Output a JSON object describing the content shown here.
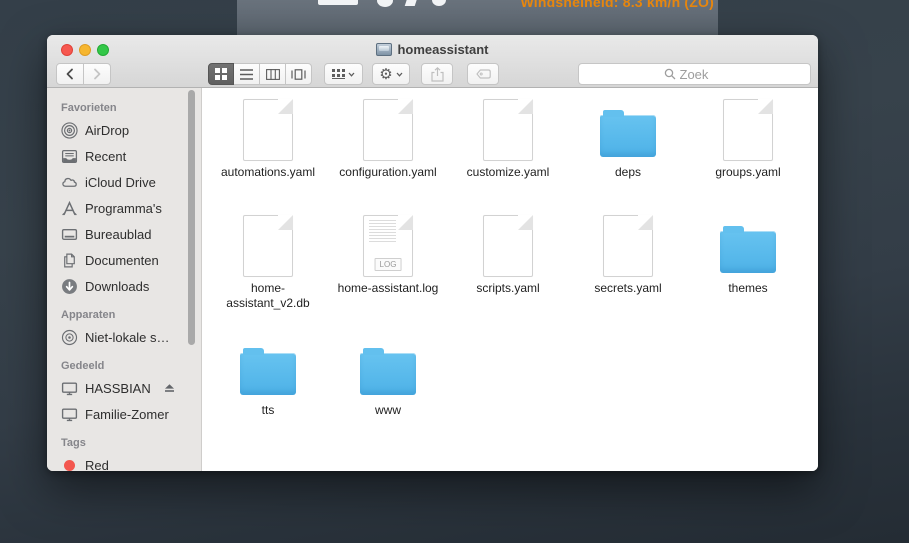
{
  "desktop": {
    "background_page": {
      "wind_label": "Windsnelheid: 8.3 km/h (ZO)",
      "accent_color": "#e8870e"
    }
  },
  "window": {
    "title": "homeassistant",
    "toolbar": {
      "search_placeholder": "Zoek"
    },
    "sidebar": {
      "sections": [
        {
          "title": "Favorieten",
          "items": [
            "AirDrop",
            "Recent",
            "iCloud Drive",
            "Programma's",
            "Bureaublad",
            "Documenten",
            "Downloads"
          ]
        },
        {
          "title": "Apparaten",
          "items": [
            "Niet-lokale s…"
          ]
        },
        {
          "title": "Gedeeld",
          "items": [
            "HASSBIAN",
            "Familie-Zomer"
          ]
        },
        {
          "title": "Tags",
          "items": [
            "Red"
          ]
        }
      ]
    },
    "content": {
      "folder_color": "#5bbcee",
      "items": [
        {
          "label": "automations.yaml",
          "type": "file"
        },
        {
          "label": "configuration.yaml",
          "type": "file"
        },
        {
          "label": "customize.yaml",
          "type": "file"
        },
        {
          "label": "deps",
          "type": "folder"
        },
        {
          "label": "groups.yaml",
          "type": "file"
        },
        {
          "label": "home-assistant_v2.db",
          "type": "file"
        },
        {
          "label": "home-assistant.log",
          "type": "log",
          "badge": "LOG"
        },
        {
          "label": "scripts.yaml",
          "type": "file"
        },
        {
          "label": "secrets.yaml",
          "type": "file"
        },
        {
          "label": "themes",
          "type": "folder"
        },
        {
          "label": "tts",
          "type": "folder"
        },
        {
          "label": "www",
          "type": "folder"
        }
      ]
    }
  }
}
